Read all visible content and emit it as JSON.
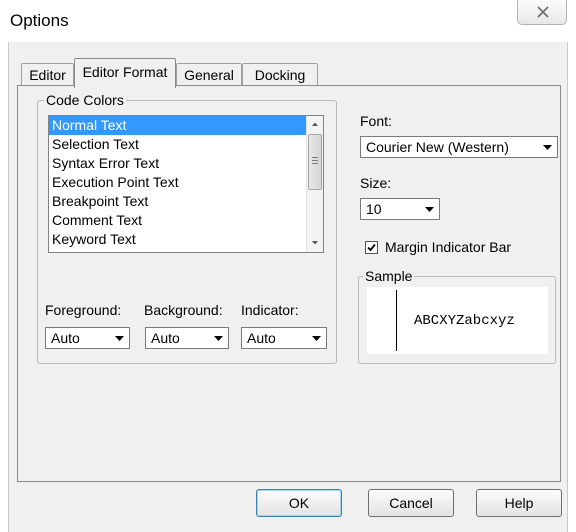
{
  "window": {
    "title": "Options",
    "close_icon": "close-icon"
  },
  "tabs": [
    {
      "label": "Editor",
      "active": false
    },
    {
      "label": "Editor Format",
      "active": true
    },
    {
      "label": "General",
      "active": false
    },
    {
      "label": "Docking",
      "active": false
    }
  ],
  "code_colors": {
    "label": "Code Colors",
    "items": [
      {
        "label": "Normal Text",
        "selected": true
      },
      {
        "label": "Selection Text",
        "selected": false
      },
      {
        "label": "Syntax Error Text",
        "selected": false
      },
      {
        "label": "Execution Point Text",
        "selected": false
      },
      {
        "label": "Breakpoint Text",
        "selected": false
      },
      {
        "label": "Comment Text",
        "selected": false
      },
      {
        "label": "Keyword Text",
        "selected": false
      }
    ],
    "foreground": {
      "label": "Foreground:",
      "value": "Auto"
    },
    "background": {
      "label": "Background:",
      "value": "Auto"
    },
    "indicator": {
      "label": "Indicator:",
      "value": "Auto"
    }
  },
  "font": {
    "label": "Font:",
    "value": "Courier New (Western)"
  },
  "size": {
    "label": "Size:",
    "value": "10"
  },
  "margin_indicator": {
    "label": "Margin Indicator Bar",
    "checked": true
  },
  "sample": {
    "label": "Sample",
    "text": "ABCXYZabcxyz"
  },
  "buttons": {
    "ok": "OK",
    "cancel": "Cancel",
    "help": "Help"
  },
  "colors": {
    "selection": "#3399ff",
    "dialog_bg": "#f0f0f0"
  }
}
